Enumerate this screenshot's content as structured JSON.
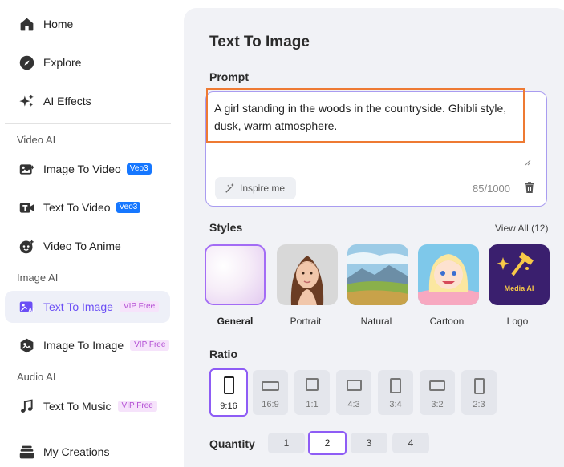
{
  "sidebar": {
    "nav": [
      {
        "label": "Home",
        "icon": "home-icon"
      },
      {
        "label": "Explore",
        "icon": "compass-icon"
      },
      {
        "label": "AI Effects",
        "icon": "sparkles-icon"
      }
    ],
    "video_section": "Video AI",
    "video_items": [
      {
        "label": "Image To Video",
        "badge": "Veo3",
        "icon": "image-to-video-icon"
      },
      {
        "label": "Text To Video",
        "badge": "Veo3",
        "icon": "text-to-video-icon"
      },
      {
        "label": "Video To Anime",
        "icon": "anime-face-icon"
      }
    ],
    "image_section": "Image AI",
    "image_items": [
      {
        "label": "Text To Image",
        "badge": "VIP Free",
        "icon": "text-to-image-icon",
        "active": true
      },
      {
        "label": "Image To Image",
        "badge": "VIP Free",
        "icon": "image-to-image-icon"
      }
    ],
    "audio_section": "Audio AI",
    "audio_items": [
      {
        "label": "Text To Music",
        "badge": "VIP Free",
        "icon": "music-note-icon"
      }
    ],
    "footer_item": {
      "label": "My Creations",
      "icon": "stack-icon"
    }
  },
  "main": {
    "title": "Text To Image",
    "prompt_label": "Prompt",
    "prompt_text": "A girl standing in the woods in the countryside. Ghibli style, dusk, warm atmosphere.",
    "inspire_label": "Inspire me",
    "char_count": "85/1000",
    "styles_label": "Styles",
    "view_all": "View All (12)",
    "styles": [
      {
        "label": "General",
        "selected": true
      },
      {
        "label": "Portrait"
      },
      {
        "label": "Natural"
      },
      {
        "label": "Cartoon"
      },
      {
        "label": "Logo",
        "logo_text": "Media AI"
      }
    ],
    "ratio_label": "Ratio",
    "ratios": [
      "9:16",
      "16:9",
      "1:1",
      "4:3",
      "3:4",
      "3:2",
      "2:3"
    ],
    "selected_ratio": "9:16",
    "quantity_label": "Quantity",
    "quantities": [
      "1",
      "2",
      "3",
      "4"
    ],
    "selected_quantity": "2"
  },
  "colors": {
    "accent": "#8e5cf5",
    "veo_badge": "#1677ff",
    "vip_badge_text": "#b34fd4",
    "highlight": "#ee7a33",
    "panel_bg": "#f1f2f6"
  }
}
